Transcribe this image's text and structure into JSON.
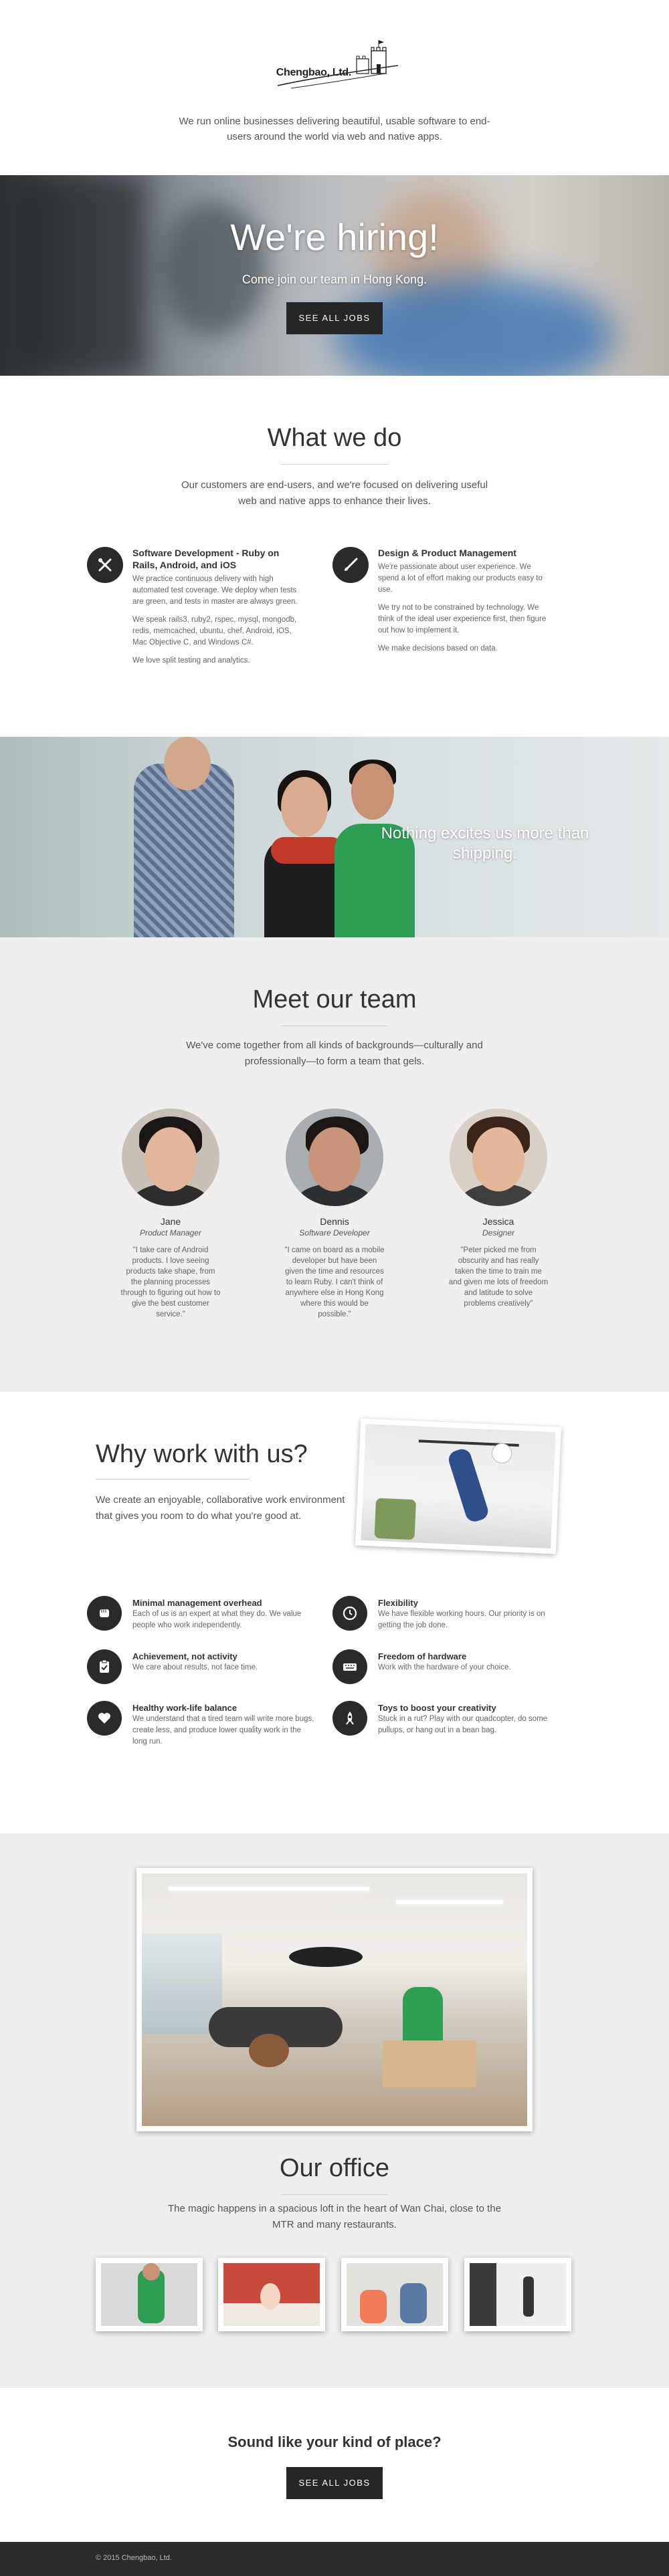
{
  "header": {
    "logo_text": "Chengbao, Ltd.",
    "tagline": "We run online businesses delivering beautiful, usable software to end-users around the world via web and native apps."
  },
  "hero": {
    "title": "We're hiring!",
    "subtitle": "Come join our team in Hong Kong.",
    "button": "SEE ALL JOBS"
  },
  "what_we_do": {
    "title": "What we do",
    "lead": "Our customers are end-users, and we're focused on delivering useful web and native apps to enhance their lives.",
    "features": [
      {
        "icon": "tools-icon",
        "title": "Software Development - Ruby on Rails, Android, and iOS",
        "paragraphs": [
          "We practice continuous delivery with high automated test coverage. We deploy when tests are green, and tests in master are always green.",
          "We speak rails3, ruby2, rspec, mysql, mongodb, redis, memcached, ubuntu, chef, Android, iOS, Mac Objective C, and Windows C#.",
          "We love split testing and analytics."
        ]
      },
      {
        "icon": "paintbrush-icon",
        "title": "Design & Product Management",
        "paragraphs": [
          "We're passionate about user experience. We spend a lot of effort making our products easy to use.",
          "We try not to be constrained by technology. We think of the ideal user experience first, then figure out how to implement it.",
          "We make decisions based on data."
        ]
      }
    ]
  },
  "banner": {
    "text": "Nothing excites us more than shipping."
  },
  "team": {
    "title": "Meet our team",
    "lead": "We've come together from all kinds of backgrounds—culturally and professionally—to form a team that gels.",
    "members": [
      {
        "name": "Jane",
        "role": "Product Manager",
        "quote": "\"I take care of Android products. I love seeing products take shape, from the planning processes through to figuring out how to give the best customer service.\""
      },
      {
        "name": "Dennis",
        "role": "Software Developer",
        "quote": "\"I came on board as a mobile developer but have been given the time and resources to learn Ruby. I can't think of anywhere else in Hong Kong where this would be possible.\""
      },
      {
        "name": "Jessica",
        "role": "Designer",
        "quote": "\"Peter picked me from obscurity and has really taken the time to train me and given me lots of freedom and latitude to solve problems creatively\""
      }
    ]
  },
  "why": {
    "title": "Why work with us?",
    "lead": "We create an enjoyable, collaborative work environment that gives you room to do what you're good at.",
    "perks": [
      {
        "icon": "fist-icon",
        "title": "Minimal management overhead",
        "text": "Each of us is an expert at what they do. We value people who work independently."
      },
      {
        "icon": "clock-icon",
        "title": "Flexibility",
        "text": "We have flexible working hours. Our priority is on getting the job done."
      },
      {
        "icon": "clipboard-icon",
        "title": "Achievement, not activity",
        "text": "We care about results, not face time."
      },
      {
        "icon": "keyboard-icon",
        "title": "Freedom of hardware",
        "text": "Work with the hardware of your choice."
      },
      {
        "icon": "heart-icon",
        "title": "Healthy work-life balance",
        "text": "We understand that a tired team will write more bugs, create less, and produce lower quality work in the long run."
      },
      {
        "icon": "rocket-icon",
        "title": "Toys to boost your creativity",
        "text": "Stuck in a rut? Play with our quadcopter, do some pullups, or hang out in a bean bag."
      }
    ]
  },
  "office": {
    "title": "Our office",
    "lead": "The magic happens in a spacious loft in the heart of Wan Chai, close to the MTR and many restaurants."
  },
  "cta": {
    "title": "Sound like your kind of place?",
    "button": "SEE ALL JOBS"
  },
  "footer": {
    "copyright": "© 2015 Chengbao, Ltd."
  }
}
